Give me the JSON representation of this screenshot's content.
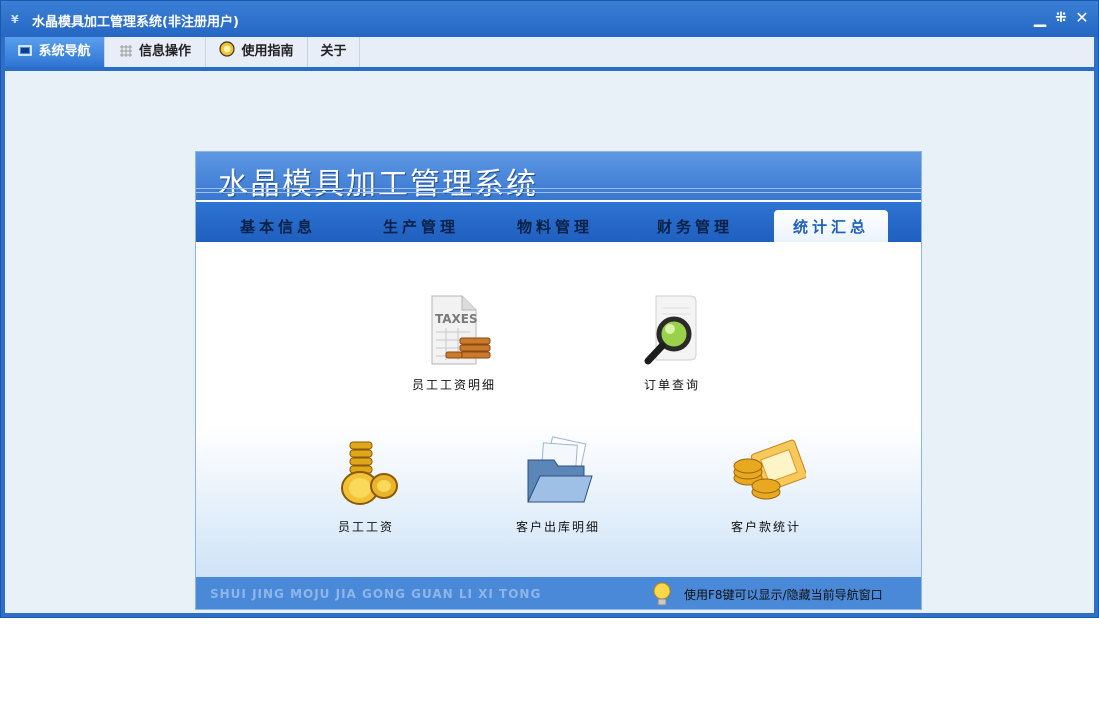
{
  "window": {
    "title": "水晶模具加工管理系统(非注册用户)",
    "app_icon": "logo-icon",
    "controls": {
      "minimize": "▁",
      "restore": "⁜",
      "close": "✕"
    }
  },
  "menubar": {
    "tabs": [
      {
        "label": "系统导航",
        "icon": "monitor-icon",
        "active": true
      },
      {
        "label": "信息操作",
        "icon": "grid-icon",
        "active": false
      },
      {
        "label": "使用指南",
        "icon": "help-icon",
        "active": false
      },
      {
        "label": "关于",
        "active": false
      }
    ]
  },
  "panel": {
    "title": "水晶模具加工管理系统",
    "tabs": [
      {
        "label": "基本信息",
        "active": false
      },
      {
        "label": "生产管理",
        "active": false
      },
      {
        "label": "物料管理",
        "active": false
      },
      {
        "label": "财务管理",
        "active": false
      },
      {
        "label": "统计汇总",
        "active": true
      }
    ],
    "items": [
      {
        "label": "员工工资明细",
        "icon": "taxes-report-icon"
      },
      {
        "label": "订单查询",
        "icon": "magnifier-document-icon"
      },
      {
        "label": "员工工资",
        "icon": "gold-coins-icon"
      },
      {
        "label": "客户出库明细",
        "icon": "open-folder-documents-icon"
      },
      {
        "label": "客户款统计",
        "icon": "coins-envelope-icon"
      }
    ],
    "footer": {
      "pinyin": "SHUI JING MOJU JIA GONG GUAN LI XI TONG",
      "tip": "使用F8键可以显示/隐藏当前导航窗口",
      "tip_icon": "lightbulb-icon"
    },
    "taxes_text": "TAXES"
  },
  "colors": {
    "titlebar": "#2567c3",
    "active_tab": "#2f74d2",
    "panel_header": "#3a78d0",
    "footer": "#4a88d8"
  }
}
